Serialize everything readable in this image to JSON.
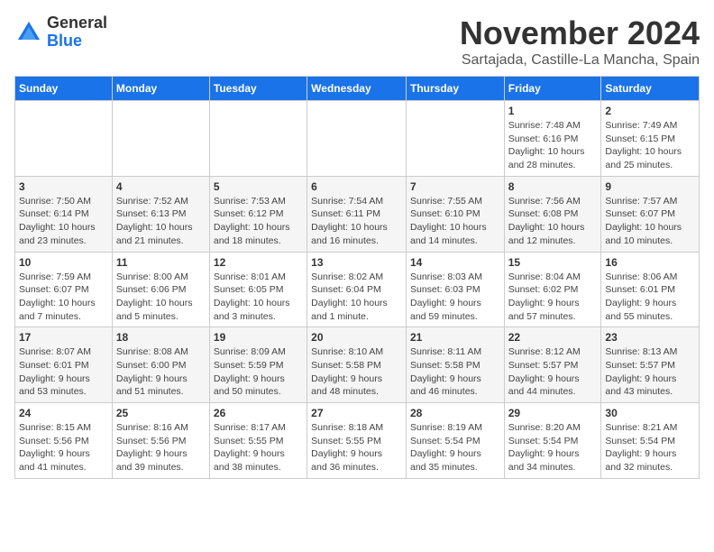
{
  "header": {
    "logo_general": "General",
    "logo_blue": "Blue",
    "month": "November 2024",
    "location": "Sartajada, Castille-La Mancha, Spain"
  },
  "weekdays": [
    "Sunday",
    "Monday",
    "Tuesday",
    "Wednesday",
    "Thursday",
    "Friday",
    "Saturday"
  ],
  "weeks": [
    [
      {
        "day": "",
        "info": ""
      },
      {
        "day": "",
        "info": ""
      },
      {
        "day": "",
        "info": ""
      },
      {
        "day": "",
        "info": ""
      },
      {
        "day": "",
        "info": ""
      },
      {
        "day": "1",
        "info": "Sunrise: 7:48 AM\nSunset: 6:16 PM\nDaylight: 10 hours\nand 28 minutes."
      },
      {
        "day": "2",
        "info": "Sunrise: 7:49 AM\nSunset: 6:15 PM\nDaylight: 10 hours\nand 25 minutes."
      }
    ],
    [
      {
        "day": "3",
        "info": "Sunrise: 7:50 AM\nSunset: 6:14 PM\nDaylight: 10 hours\nand 23 minutes."
      },
      {
        "day": "4",
        "info": "Sunrise: 7:52 AM\nSunset: 6:13 PM\nDaylight: 10 hours\nand 21 minutes."
      },
      {
        "day": "5",
        "info": "Sunrise: 7:53 AM\nSunset: 6:12 PM\nDaylight: 10 hours\nand 18 minutes."
      },
      {
        "day": "6",
        "info": "Sunrise: 7:54 AM\nSunset: 6:11 PM\nDaylight: 10 hours\nand 16 minutes."
      },
      {
        "day": "7",
        "info": "Sunrise: 7:55 AM\nSunset: 6:10 PM\nDaylight: 10 hours\nand 14 minutes."
      },
      {
        "day": "8",
        "info": "Sunrise: 7:56 AM\nSunset: 6:08 PM\nDaylight: 10 hours\nand 12 minutes."
      },
      {
        "day": "9",
        "info": "Sunrise: 7:57 AM\nSunset: 6:07 PM\nDaylight: 10 hours\nand 10 minutes."
      }
    ],
    [
      {
        "day": "10",
        "info": "Sunrise: 7:59 AM\nSunset: 6:07 PM\nDaylight: 10 hours\nand 7 minutes."
      },
      {
        "day": "11",
        "info": "Sunrise: 8:00 AM\nSunset: 6:06 PM\nDaylight: 10 hours\nand 5 minutes."
      },
      {
        "day": "12",
        "info": "Sunrise: 8:01 AM\nSunset: 6:05 PM\nDaylight: 10 hours\nand 3 minutes."
      },
      {
        "day": "13",
        "info": "Sunrise: 8:02 AM\nSunset: 6:04 PM\nDaylight: 10 hours\nand 1 minute."
      },
      {
        "day": "14",
        "info": "Sunrise: 8:03 AM\nSunset: 6:03 PM\nDaylight: 9 hours\nand 59 minutes."
      },
      {
        "day": "15",
        "info": "Sunrise: 8:04 AM\nSunset: 6:02 PM\nDaylight: 9 hours\nand 57 minutes."
      },
      {
        "day": "16",
        "info": "Sunrise: 8:06 AM\nSunset: 6:01 PM\nDaylight: 9 hours\nand 55 minutes."
      }
    ],
    [
      {
        "day": "17",
        "info": "Sunrise: 8:07 AM\nSunset: 6:01 PM\nDaylight: 9 hours\nand 53 minutes."
      },
      {
        "day": "18",
        "info": "Sunrise: 8:08 AM\nSunset: 6:00 PM\nDaylight: 9 hours\nand 51 minutes."
      },
      {
        "day": "19",
        "info": "Sunrise: 8:09 AM\nSunset: 5:59 PM\nDaylight: 9 hours\nand 50 minutes."
      },
      {
        "day": "20",
        "info": "Sunrise: 8:10 AM\nSunset: 5:58 PM\nDaylight: 9 hours\nand 48 minutes."
      },
      {
        "day": "21",
        "info": "Sunrise: 8:11 AM\nSunset: 5:58 PM\nDaylight: 9 hours\nand 46 minutes."
      },
      {
        "day": "22",
        "info": "Sunrise: 8:12 AM\nSunset: 5:57 PM\nDaylight: 9 hours\nand 44 minutes."
      },
      {
        "day": "23",
        "info": "Sunrise: 8:13 AM\nSunset: 5:57 PM\nDaylight: 9 hours\nand 43 minutes."
      }
    ],
    [
      {
        "day": "24",
        "info": "Sunrise: 8:15 AM\nSunset: 5:56 PM\nDaylight: 9 hours\nand 41 minutes."
      },
      {
        "day": "25",
        "info": "Sunrise: 8:16 AM\nSunset: 5:56 PM\nDaylight: 9 hours\nand 39 minutes."
      },
      {
        "day": "26",
        "info": "Sunrise: 8:17 AM\nSunset: 5:55 PM\nDaylight: 9 hours\nand 38 minutes."
      },
      {
        "day": "27",
        "info": "Sunrise: 8:18 AM\nSunset: 5:55 PM\nDaylight: 9 hours\nand 36 minutes."
      },
      {
        "day": "28",
        "info": "Sunrise: 8:19 AM\nSunset: 5:54 PM\nDaylight: 9 hours\nand 35 minutes."
      },
      {
        "day": "29",
        "info": "Sunrise: 8:20 AM\nSunset: 5:54 PM\nDaylight: 9 hours\nand 34 minutes."
      },
      {
        "day": "30",
        "info": "Sunrise: 8:21 AM\nSunset: 5:54 PM\nDaylight: 9 hours\nand 32 minutes."
      }
    ]
  ]
}
